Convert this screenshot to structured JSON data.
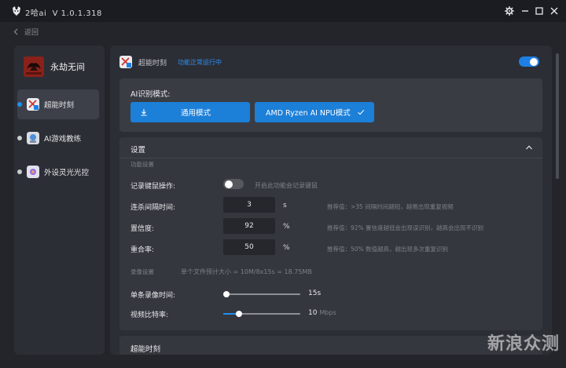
{
  "titlebar": {
    "app_name": "2哈ai",
    "version": "V 1.0.1.318"
  },
  "nav": {
    "back_label": "返回"
  },
  "sidebar": {
    "brand_name": "永劫无间",
    "brand_logo_text": "NARAKA",
    "items": [
      {
        "label": "超能时刻",
        "active": true
      },
      {
        "label": "AI游戏教练",
        "active": false
      },
      {
        "label": "外设灵光光控",
        "active": false
      }
    ]
  },
  "feature": {
    "title": "超能时刻",
    "status": "功能正常运行中",
    "enabled": true
  },
  "ai_mode": {
    "label": "AI识别模式:",
    "buttons": [
      {
        "label": "通用模式",
        "icon": "download-icon"
      },
      {
        "label": "AMD Ryzen AI NPU模式",
        "icon": "check-icon",
        "selected": true
      }
    ]
  },
  "settings": {
    "title": "设置",
    "function_section": "功能设置",
    "record_key": {
      "label": "记录键鼠操作:",
      "enabled": false,
      "hint": "开启此功能会记录键鼠"
    },
    "rows": [
      {
        "label": "连杀间隔时间:",
        "value": "3",
        "unit": "s",
        "hint": "推荐值：>35 间隔时间越短，越易出现重复视频"
      },
      {
        "label": "置信度:",
        "value": "92",
        "unit": "%",
        "hint": "推荐值：92% 置信度越低会出现误识别，越高会出现不识别"
      },
      {
        "label": "重合率:",
        "value": "50",
        "unit": "%",
        "hint": "推荐值：50% 数值越高，越出现多次重复识别"
      }
    ],
    "record_section": "录像设置",
    "record_size_hint": "单个文件预计大小 = 10M/8x15s = 18.75MB",
    "sliders": [
      {
        "label": "单条录像时间:",
        "value": "15s",
        "unit": "",
        "fraction": 0.0
      },
      {
        "label": "视频比特率:",
        "value": "10",
        "unit": "Mbps",
        "fraction": 0.16
      }
    ]
  },
  "bottom_section": {
    "title": "超能时刻"
  },
  "watermark": "新浪众测",
  "colors": {
    "accent": "#1f7fe6",
    "panel": "#2c2e35",
    "background": "#23252b"
  }
}
